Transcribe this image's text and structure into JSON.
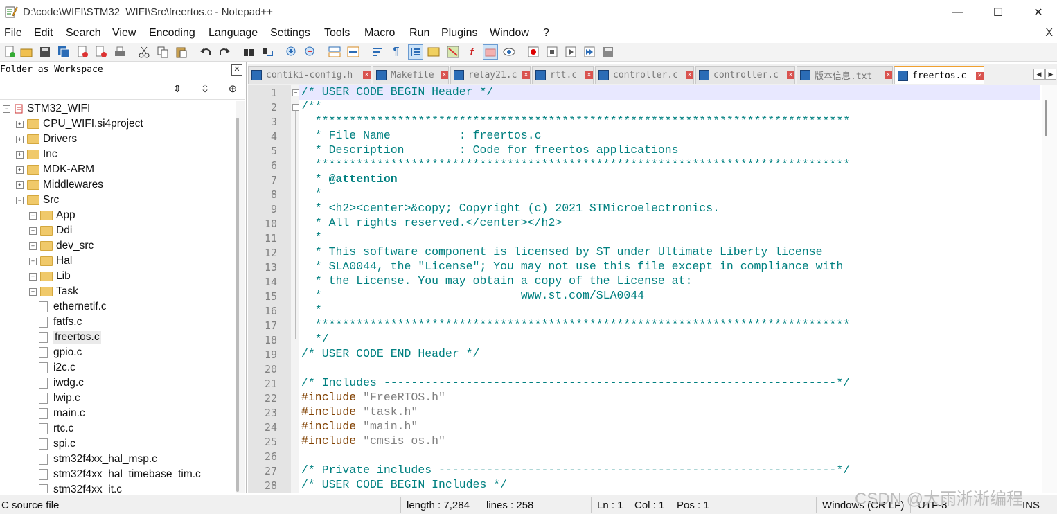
{
  "window": {
    "title": "D:\\code\\WIFI\\STM32_WIFI\\Src\\freertos.c - Notepad++",
    "minimize": "—",
    "maximize": "☐",
    "close": "✕"
  },
  "menu": {
    "items": [
      "File",
      "Edit",
      "Search",
      "View",
      "Encoding",
      "Language",
      "Settings",
      "Tools",
      "Macro",
      "Run",
      "Plugins",
      "Window",
      "?"
    ],
    "close": "X"
  },
  "toolbar": {
    "icons": [
      "new-file-icon",
      "open-file-icon",
      "save-icon",
      "save-all-icon",
      "close-icon",
      "close-all-icon",
      "print-icon",
      "cut-icon",
      "copy-icon",
      "paste-icon",
      "undo-icon",
      "redo-icon",
      "find-icon",
      "replace-icon",
      "zoom-in-icon",
      "zoom-out-icon",
      "sync-vertical-icon",
      "sync-horizontal-icon",
      "word-wrap-icon",
      "show-all-chars-icon",
      "indent-guide-icon",
      "udl-icon",
      "document-map-icon",
      "function-list-icon",
      "folder-workspace-icon",
      "monitoring-icon",
      "record-macro-icon",
      "stop-record-icon",
      "play-macro-icon",
      "run-macro-multiple-icon",
      "save-macro-icon"
    ]
  },
  "folder_panel": {
    "title": "Folder as Workspace",
    "close": "✕",
    "tools": {
      "collapse": "⇕",
      "expand": "⇳",
      "locate": "⊕"
    },
    "tree": [
      {
        "label": "STM32_WIFI",
        "kind": "project",
        "level": 0,
        "state": "−"
      },
      {
        "label": "CPU_WIFI.si4project",
        "kind": "folder",
        "level": 1,
        "state": "+"
      },
      {
        "label": "Drivers",
        "kind": "folder",
        "level": 1,
        "state": "+"
      },
      {
        "label": "Inc",
        "kind": "folder",
        "level": 1,
        "state": "+"
      },
      {
        "label": "MDK-ARM",
        "kind": "folder",
        "level": 1,
        "state": "+"
      },
      {
        "label": "Middlewares",
        "kind": "folder",
        "level": 1,
        "state": "+"
      },
      {
        "label": "Src",
        "kind": "folder",
        "level": 1,
        "state": "−"
      },
      {
        "label": "App",
        "kind": "folder",
        "level": 2,
        "state": "+"
      },
      {
        "label": "Ddi",
        "kind": "folder",
        "level": 2,
        "state": "+"
      },
      {
        "label": "dev_src",
        "kind": "folder",
        "level": 2,
        "state": "+"
      },
      {
        "label": "Hal",
        "kind": "folder",
        "level": 2,
        "state": "+"
      },
      {
        "label": "Lib",
        "kind": "folder",
        "level": 2,
        "state": "+"
      },
      {
        "label": "Task",
        "kind": "folder",
        "level": 2,
        "state": "+"
      },
      {
        "label": "ethernetif.c",
        "kind": "file",
        "level": 2
      },
      {
        "label": "fatfs.c",
        "kind": "file",
        "level": 2
      },
      {
        "label": "freertos.c",
        "kind": "file",
        "level": 2,
        "selected": true
      },
      {
        "label": "gpio.c",
        "kind": "file",
        "level": 2
      },
      {
        "label": "i2c.c",
        "kind": "file",
        "level": 2
      },
      {
        "label": "iwdg.c",
        "kind": "file",
        "level": 2
      },
      {
        "label": "lwip.c",
        "kind": "file",
        "level": 2
      },
      {
        "label": "main.c",
        "kind": "file",
        "level": 2
      },
      {
        "label": "rtc.c",
        "kind": "file",
        "level": 2
      },
      {
        "label": "spi.c",
        "kind": "file",
        "level": 2
      },
      {
        "label": "stm32f4xx_hal_msp.c",
        "kind": "file",
        "level": 2
      },
      {
        "label": "stm32f4xx_hal_timebase_tim.c",
        "kind": "file",
        "level": 2
      },
      {
        "label": "stm32f4xx_it.c",
        "kind": "file",
        "level": 2
      }
    ]
  },
  "tabs": [
    {
      "label": "contiki-config.h",
      "active": false
    },
    {
      "label": "Makefile",
      "active": false
    },
    {
      "label": "relay21.c",
      "active": false
    },
    {
      "label": "rtt.c",
      "active": false
    },
    {
      "label": "controller.c",
      "active": false
    },
    {
      "label": "controller.c",
      "active": false
    },
    {
      "label": "版本信息.txt",
      "active": false
    },
    {
      "label": "freertos.c",
      "active": true
    }
  ],
  "tab_close": "✕",
  "tab_nav": {
    "left": "◀",
    "right": "▶"
  },
  "editor": {
    "lines": [
      {
        "n": "1",
        "text": "/* USER CODE BEGIN Header */",
        "type": "comment"
      },
      {
        "n": "2",
        "text": "/**",
        "type": "comment"
      },
      {
        "n": "3",
        "text": "  ******************************************************************************",
        "type": "comment"
      },
      {
        "n": "4",
        "text": "  * File Name          : freertos.c",
        "type": "comment"
      },
      {
        "n": "5",
        "text": "  * Description        : Code for freertos applications",
        "type": "comment"
      },
      {
        "n": "6",
        "text": "  ******************************************************************************",
        "type": "comment"
      },
      {
        "n": "7",
        "text": "  * @attention",
        "type": "comment"
      },
      {
        "n": "8",
        "text": "  *",
        "type": "comment"
      },
      {
        "n": "9",
        "text": "  * <h2><center>&copy; Copyright (c) 2021 STMicroelectronics.",
        "type": "comment"
      },
      {
        "n": "10",
        "text": "  * All rights reserved.</center></h2>",
        "type": "comment"
      },
      {
        "n": "11",
        "text": "  *",
        "type": "comment"
      },
      {
        "n": "12",
        "text": "  * This software component is licensed by ST under Ultimate Liberty license",
        "type": "comment"
      },
      {
        "n": "13",
        "text": "  * SLA0044, the \"License\"; You may not use this file except in compliance with",
        "type": "comment"
      },
      {
        "n": "14",
        "text": "  * the License. You may obtain a copy of the License at:",
        "type": "comment"
      },
      {
        "n": "15",
        "text": "  *                             www.st.com/SLA0044",
        "type": "comment"
      },
      {
        "n": "16",
        "text": "  *",
        "type": "comment"
      },
      {
        "n": "17",
        "text": "  ******************************************************************************",
        "type": "comment"
      },
      {
        "n": "18",
        "text": "  */",
        "type": "comment"
      },
      {
        "n": "19",
        "text": "/* USER CODE END Header */",
        "type": "comment"
      },
      {
        "n": "20",
        "text": "",
        "type": "comment"
      },
      {
        "n": "21",
        "text": "/* Includes ------------------------------------------------------------------*/",
        "type": "comment"
      },
      {
        "n": "22",
        "text": "#include \"FreeRTOS.h\"",
        "type": "pp"
      },
      {
        "n": "23",
        "text": "#include \"task.h\"",
        "type": "pp"
      },
      {
        "n": "24",
        "text": "#include \"main.h\"",
        "type": "pp"
      },
      {
        "n": "25",
        "text": "#include \"cmsis_os.h\"",
        "type": "pp"
      },
      {
        "n": "26",
        "text": "",
        "type": "comment"
      },
      {
        "n": "27",
        "text": "/* Private includes ----------------------------------------------------------*/",
        "type": "comment"
      },
      {
        "n": "28",
        "text": "/* USER CODE BEGIN Includes */",
        "type": "comment"
      }
    ],
    "fold_minus": "−"
  },
  "status": {
    "file_type": "C source file",
    "length": "length : 7,284",
    "lines": "lines : 258",
    "ln": "Ln : 1",
    "col": "Col : 1",
    "pos": "Pos : 1",
    "eol": "Windows (CR LF)",
    "encoding": "UTF-8",
    "mode": "INS"
  },
  "watermark": "CSDN @大雨淅淅编程",
  "colors": {
    "comment": "#008080",
    "preprocessor": "#804000",
    "string": "#808080",
    "current_line": "#e8e8ff",
    "active_tab_accent": "#f0a030"
  }
}
